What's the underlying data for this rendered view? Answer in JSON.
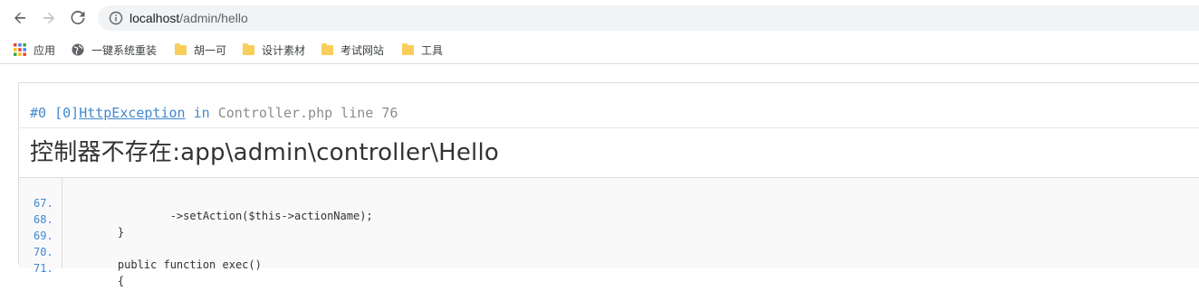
{
  "browser": {
    "url_host": "localhost",
    "url_path": "/admin/hello",
    "bookmarks": [
      {
        "label": "应用",
        "icon": "apps-grid-icon"
      },
      {
        "label": "一键系统重装",
        "icon": "globe-icon"
      },
      {
        "label": "胡一可",
        "icon": "folder-icon"
      },
      {
        "label": "设计素材",
        "icon": "folder-icon"
      },
      {
        "label": "考试网站",
        "icon": "folder-icon"
      },
      {
        "label": "工具",
        "icon": "folder-icon"
      }
    ]
  },
  "exception": {
    "trace_num": "#0 [0]",
    "class_name": "HttpException",
    "in_word": "in",
    "location": "Controller.php line 76",
    "message": "控制器不存在:app\\admin\\controller\\Hello",
    "source": [
      {
        "line": "67.",
        "code": "            ->setAction($this->actionName);"
      },
      {
        "line": "68.",
        "code": "    }"
      },
      {
        "line": "69.",
        "code": ""
      },
      {
        "line": "70.",
        "code": "    public function exec()"
      },
      {
        "line": "71.",
        "code": "    {"
      }
    ]
  },
  "colors": {
    "link_blue": "#4288ce",
    "folder_yellow": "#f9ce5b",
    "omnibox_bg": "#f1f3f4"
  }
}
